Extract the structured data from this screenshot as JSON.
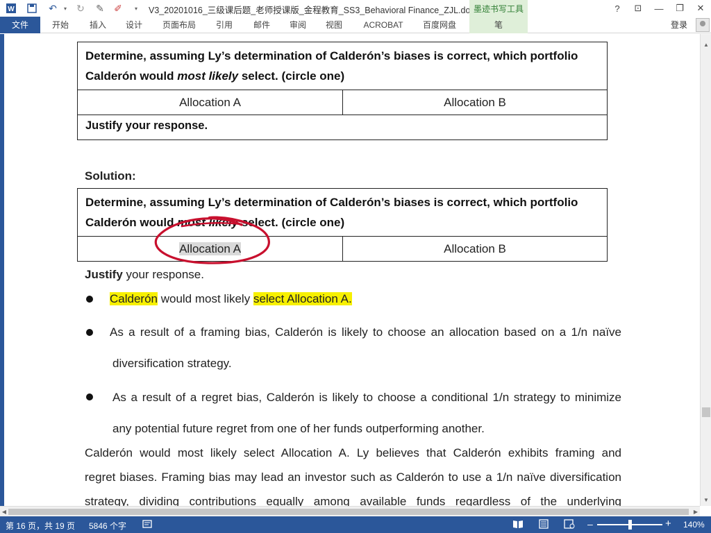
{
  "titlebar": {
    "doc_title": "V3_20201016_三级课后题_老师授课版_金程教育_SS3_Behavioral Finance_ZJL.do...",
    "ink_tools": "墨迹书写工具",
    "help": "?",
    "minimize": "—"
  },
  "ribbon": {
    "tabs": [
      "文件",
      "开始",
      "插入",
      "设计",
      "页面布局",
      "引用",
      "邮件",
      "审阅",
      "视图",
      "ACROBAT",
      "百度网盘",
      "笔"
    ],
    "login": "登录"
  },
  "document": {
    "table1": {
      "question_line1": "Determine, assuming Ly’s determination of Calderón’s biases is correct, which portfolio",
      "question_line2_a": "Calderón would ",
      "question_line2_b": "most likely",
      "question_line2_c": " select. (circle one)",
      "option_a": "Allocation A",
      "option_b": "Allocation B",
      "justify": "Justify your response."
    },
    "solution_label": "Solution:",
    "table2": {
      "question_line1": "Determine, assuming Ly’s determination of Calderón’s biases is correct, which portfolio",
      "question_line2_a": "Calderón would ",
      "question_line2_b": "most likely",
      "question_line2_c": " select. (circle one)",
      "option_a": "Allocation A",
      "option_b": "Allocation B"
    },
    "justify_bold": "Justify",
    "justify_rest": " your response.",
    "bullets": [
      {
        "p1": "Calderón",
        "p2": " would most likely ",
        "p3": "select Allocation A."
      },
      {
        "line1": "As a result of a framing bias, Calderón is likely to choose an allocation based on a 1/n naïve",
        "line2": "diversification strategy."
      },
      {
        "line1": "As a result of a regret bias, Calderón is likely to choose a conditional 1/n strategy to minimize",
        "line2": "any potential future regret from one of her funds outperforming another."
      }
    ],
    "paragraph": [
      "Calderón would most likely select Allocation A. Ly believes that Calderón exhibits framing and",
      "regret biases. Framing bias may lead an investor such as Calderón to use a 1/n naïve diversification",
      "strategy, dividing contributions equally among available funds regardless of the underlying"
    ]
  },
  "statusbar": {
    "page": "第 16 页，共 19 页",
    "words": "5846 个字",
    "zoom": "140%"
  },
  "colors": {
    "accent": "#2b579a",
    "highlight": "#f7f000",
    "ink_circle": "#c8102e"
  }
}
